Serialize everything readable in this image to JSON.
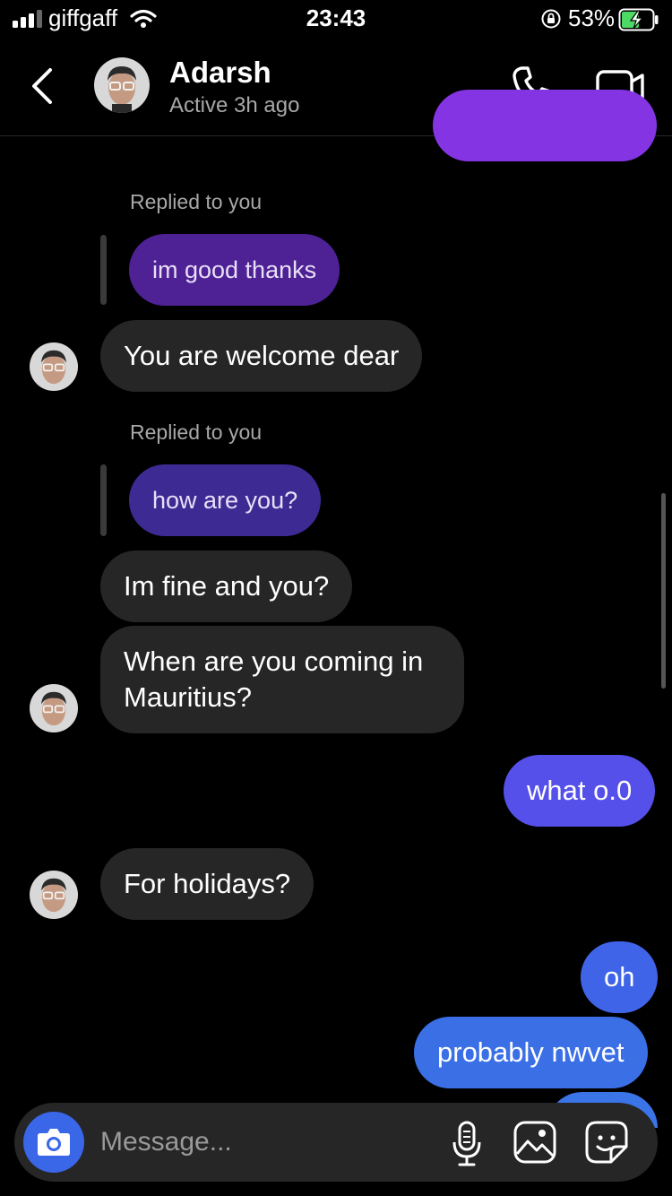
{
  "status_bar": {
    "carrier": "giffgaff",
    "time": "23:43",
    "battery_percent": "53%"
  },
  "header": {
    "contact_name": "Adarsh",
    "contact_status": "Active 3h ago",
    "icons": [
      "back-chevron-icon",
      "phone-icon",
      "video-camera-icon"
    ]
  },
  "thread": {
    "reply_label_1": "Replied to you",
    "replied_msg_1": "im good thanks",
    "their_msg_1": "You are welcome dear",
    "reply_label_2": "Replied to you",
    "replied_msg_2": "how are you?",
    "their_msg_2": "Im fine and you?",
    "their_msg_3": "When are you coming in Mauritius?",
    "my_msg_1": "what o.0",
    "their_msg_4": "For holidays?",
    "my_msg_2": "oh",
    "my_msg_3": "probably nwvet"
  },
  "composer": {
    "placeholder": "Message...",
    "icons": [
      "camera-icon",
      "microphone-icon",
      "gallery-icon",
      "sticker-icon"
    ]
  },
  "colors": {
    "background": "#000000",
    "their_bubble": "#262626",
    "my_bubble_top": "#6f3ef0",
    "my_bubble_bottom": "#3a6fe6",
    "camera_button": "#3a66e8"
  }
}
